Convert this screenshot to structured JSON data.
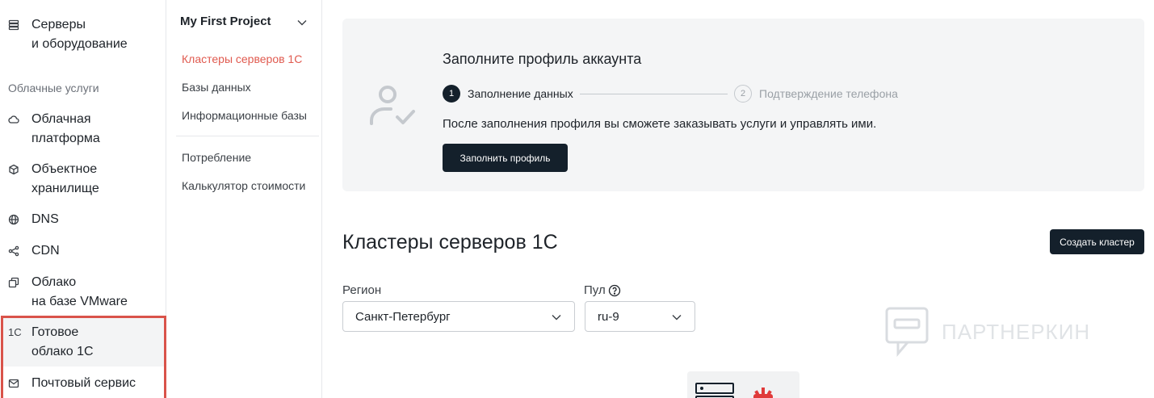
{
  "nav": {
    "items": [
      {
        "label": "Серверы\nи оборудование",
        "icon": "server-stack-icon"
      },
      {
        "label": "Облачная\nплатформа",
        "icon": "cloud-icon"
      },
      {
        "label": "Объектное\nхранилище",
        "icon": "cube-icon"
      },
      {
        "label": "DNS",
        "icon": "globe-icon"
      },
      {
        "label": "CDN",
        "icon": "network-nodes-icon"
      },
      {
        "label": "Облако\nна базе VMware",
        "icon": "copy-squares-icon"
      },
      {
        "label": "Готовое\nоблако 1С",
        "icon_text": "1С"
      },
      {
        "label": "Почтовый сервис",
        "icon": "mail-icon"
      }
    ],
    "section_label": "Облачные услуги",
    "highlight_color": "#d9534a"
  },
  "project": {
    "title": "My First Project",
    "links": [
      {
        "label": "Кластеры серверов 1С",
        "active": true
      },
      {
        "label": "Базы данных"
      },
      {
        "label": "Информационные базы"
      },
      {
        "label": "Потребление"
      },
      {
        "label": "Калькулятор стоимости"
      }
    ],
    "active_color": "#e05a4f"
  },
  "banner": {
    "title": "Заполните профиль аккаунта",
    "steps": [
      {
        "num": "1",
        "label": "Заполнение данных"
      },
      {
        "num": "2",
        "label": "Подтверждение телефона"
      }
    ],
    "text": "После заполнения профиля вы сможете заказывать услуги и управлять ими.",
    "button": "Заполнить профиль"
  },
  "main": {
    "title": "Кластеры серверов 1С",
    "create_button": "Создать кластер",
    "region_label": "Регион",
    "region_value": "Санкт-Петербург",
    "pool_label": "Пул",
    "pool_value": "ru-9"
  },
  "watermark": {
    "text": "ПАРТНЕРКИН"
  },
  "colors": {
    "dark_button": "#14202b",
    "banner_bg": "#f4f5f6"
  }
}
